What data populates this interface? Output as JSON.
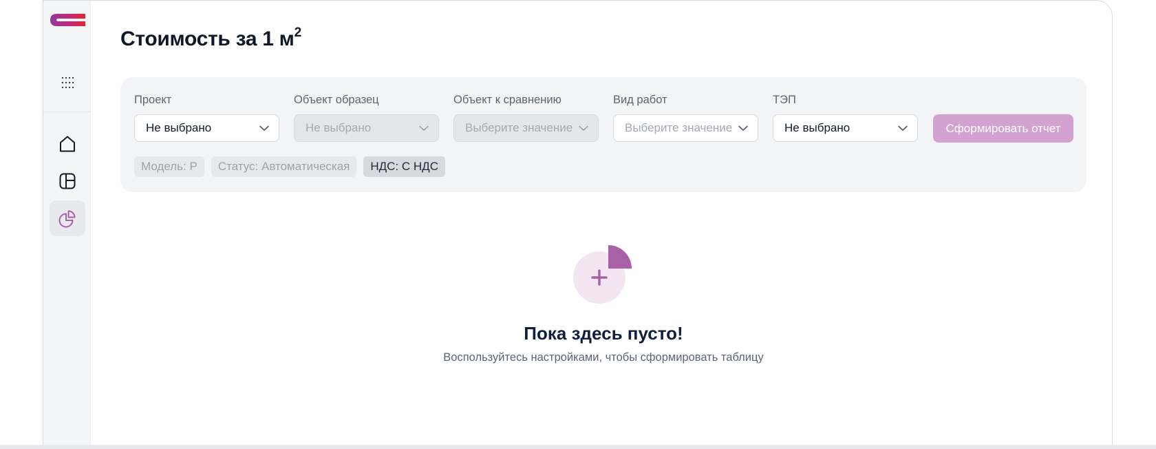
{
  "colors": {
    "accent": "#a860a6",
    "button_disabled": "#d4a2d1",
    "panel_bg": "#f3f4f6"
  },
  "sidebar": {
    "logo": "brand-logo",
    "apps_icon": "grid-dots-icon",
    "items": [
      {
        "icon": "home-icon",
        "active": false
      },
      {
        "icon": "layout-icon",
        "active": false
      },
      {
        "icon": "pie-chart-icon",
        "active": true
      }
    ]
  },
  "page": {
    "title": "Стоимость за 1 м",
    "title_sup": "2"
  },
  "filters": [
    {
      "label": "Проект",
      "value": "Не выбрано",
      "disabled": false,
      "placeholder": false
    },
    {
      "label": "Объект образец",
      "value": "Не выбрано",
      "disabled": true,
      "placeholder": false
    },
    {
      "label": "Объект к сравнению",
      "value": "Выберите значение",
      "disabled": true,
      "placeholder": true
    },
    {
      "label": "Вид работ",
      "value": "Выберите значение",
      "disabled": false,
      "placeholder": true
    },
    {
      "label": "ТЭП",
      "value": "Не выбрано",
      "disabled": false,
      "placeholder": false
    }
  ],
  "submit_label": "Сформировать отчет",
  "tags": [
    {
      "label": "Модель: Р",
      "active": false
    },
    {
      "label": "Статус: Автоматическая",
      "active": false
    },
    {
      "label": "НДС: С НДС",
      "active": true
    }
  ],
  "empty_state": {
    "title": "Пока здесь пусто!",
    "subtitle": "Воспользуйтесь настройками, чтобы сформировать таблицу"
  }
}
